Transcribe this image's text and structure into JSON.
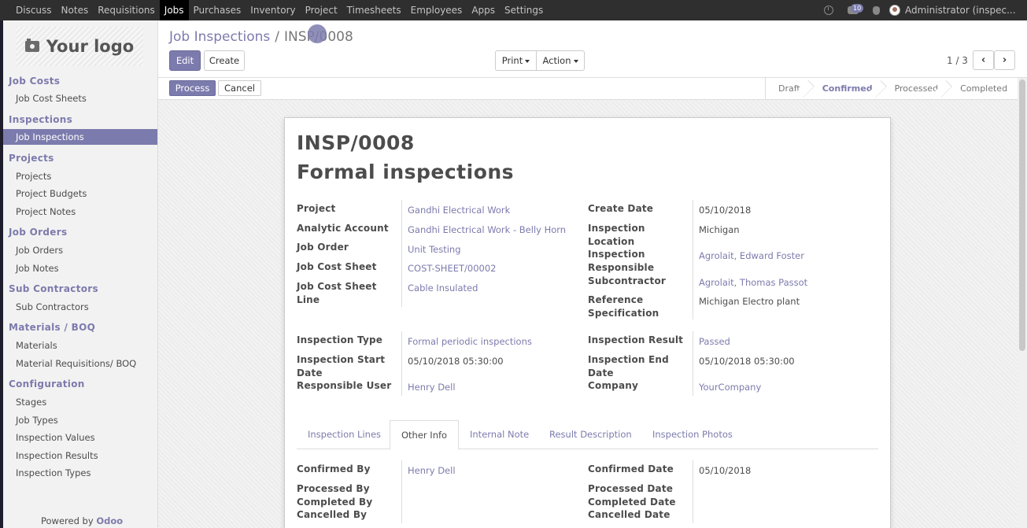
{
  "topbar": {
    "menu": [
      "Discuss",
      "Notes",
      "Requisitions",
      "Jobs",
      "Purchases",
      "Inventory",
      "Project",
      "Timesheets",
      "Employees",
      "Apps",
      "Settings"
    ],
    "active_menu": "Jobs",
    "message_count": "10",
    "user": "Administrator (inspec..."
  },
  "sidebar": {
    "logo_text": "Your logo",
    "sections": [
      {
        "title": "Job Costs",
        "items": [
          "Job Cost Sheets"
        ]
      },
      {
        "title": "Inspections",
        "items": [
          "Job Inspections"
        ]
      },
      {
        "title": "Projects",
        "items": [
          "Projects",
          "Project Budgets",
          "Project Notes"
        ]
      },
      {
        "title": "Job Orders",
        "items": [
          "Job Orders",
          "Job Notes"
        ]
      },
      {
        "title": "Sub Contractors",
        "items": [
          "Sub Contractors"
        ]
      },
      {
        "title": "Materials / BOQ",
        "items": [
          "Materials",
          "Material Requisitions/ BOQ"
        ]
      },
      {
        "title": "Configuration",
        "items": [
          "Stages",
          "Job Types",
          "Inspection Values",
          "Inspection Results",
          "Inspection Types"
        ]
      }
    ],
    "active_item": "Job Inspections",
    "powered_prefix": "Powered by",
    "powered_brand": "Odoo"
  },
  "control": {
    "breadcrumb_parent": "Job Inspections",
    "breadcrumb_separator": "/",
    "breadcrumb_current": "INSP/0008",
    "edit_label": "Edit",
    "create_label": "Create",
    "print_label": "Print",
    "action_label": "Action",
    "pager": "1 / 3"
  },
  "statusbar": {
    "process_label": "Process",
    "cancel_label": "Cancel",
    "stages": [
      "Draft",
      "Confirmed",
      "Processed",
      "Completed"
    ],
    "current_stage": "Confirmed"
  },
  "form": {
    "reference": "INSP/0008",
    "title": "Formal inspections",
    "left_fields": [
      {
        "label": "Project",
        "value": "Gandhi Electrical Work"
      },
      {
        "label": "Analytic Account",
        "value": "Gandhi Electrical Work - Belly Horn"
      },
      {
        "label": "Job Order",
        "value": "Unit Testing"
      },
      {
        "label": "Job Cost Sheet",
        "value": "COST-SHEET/00002"
      },
      {
        "label": "Job Cost Sheet Line",
        "value": "Cable Insulated"
      }
    ],
    "right_fields": [
      {
        "label": "Create Date",
        "value": "05/10/2018"
      },
      {
        "label": "Inspection Location",
        "value": "Michigan"
      },
      {
        "label": "Inspection Responsible",
        "value": "Agrolait, Edward Foster"
      },
      {
        "label": "Subcontractor",
        "value": "Agrolait, Thomas Passot"
      },
      {
        "label": "Reference Specification",
        "value": "Michigan Electro plant"
      }
    ],
    "left_fields_2": [
      {
        "label": "Inspection Type",
        "value": "Formal periodic inspections"
      },
      {
        "label": "Inspection Start Date",
        "value": "05/10/2018 05:30:00"
      },
      {
        "label": "Responsible User",
        "value": "Henry Dell"
      }
    ],
    "right_fields_2": [
      {
        "label": "Inspection Result",
        "value": "Passed"
      },
      {
        "label": "Inspection End Date",
        "value": "05/10/2018 05:30:00"
      },
      {
        "label": "Company",
        "value": "YourCompany"
      }
    ],
    "tabs": [
      "Inspection Lines",
      "Other Info",
      "Internal Note",
      "Result Description",
      "Inspection Photos"
    ],
    "active_tab": "Other Info",
    "other_info": {
      "left": [
        {
          "label": "Confirmed By",
          "value": "Henry Dell"
        },
        {
          "label": "Processed By",
          "value": ""
        },
        {
          "label": "Completed By",
          "value": ""
        },
        {
          "label": "Cancelled By",
          "value": ""
        }
      ],
      "right": [
        {
          "label": "Confirmed Date",
          "value": "05/10/2018"
        },
        {
          "label": "Processed Date",
          "value": ""
        },
        {
          "label": "Completed Date",
          "value": ""
        },
        {
          "label": "Cancelled Date",
          "value": ""
        }
      ]
    }
  }
}
